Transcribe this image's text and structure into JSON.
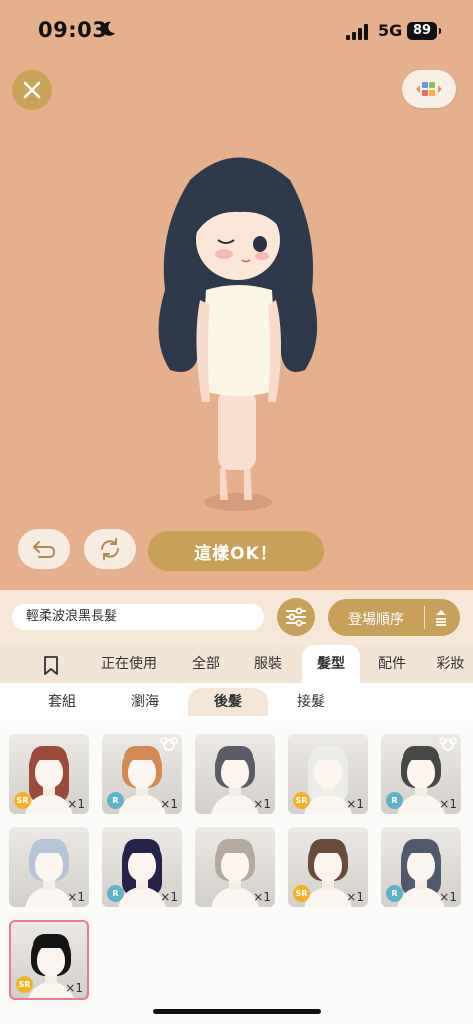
{
  "status": {
    "time": "09:03",
    "network": "5G",
    "battery": "89"
  },
  "actions": {
    "ok_label": "這樣OK！"
  },
  "item_name": "輕柔波浪黑長髮",
  "sort_label": "登場順序",
  "tabs": [
    "正在使用",
    "全部",
    "服裝",
    "髮型",
    "配件",
    "彩妝"
  ],
  "active_tab": "髮型",
  "subtabs": [
    "套組",
    "瀏海",
    "後髮",
    "接髮"
  ],
  "active_subtab": "後髮",
  "items": [
    {
      "rarity": "SR",
      "count": "×1",
      "hair": "#9c4a3a"
    },
    {
      "rarity": "R",
      "count": "×1",
      "hair": "#d38a52",
      "bear": true
    },
    {
      "rarity": "",
      "count": "×1",
      "hair": "#5b5c68"
    },
    {
      "rarity": "SR",
      "count": "×1",
      "hair": "#e9ece7"
    },
    {
      "rarity": "R",
      "count": "×1",
      "hair": "#474747",
      "bear": true
    },
    {
      "rarity": "",
      "count": "×1",
      "hair": "#b5c4d6"
    },
    {
      "rarity": "R",
      "count": "×1",
      "hair": "#26224a"
    },
    {
      "rarity": "",
      "count": "×1",
      "hair": "#b4aaa2"
    },
    {
      "rarity": "SR",
      "count": "×1",
      "hair": "#6b4a3c"
    },
    {
      "rarity": "R",
      "count": "×1",
      "hair": "#505a6c"
    },
    {
      "rarity": "SR",
      "count": "×1",
      "hair": "#151515",
      "selected": true
    }
  ],
  "colors": {
    "background": "#e5b08c",
    "gold": "#c7a05a",
    "selected_border": "#e87b95"
  }
}
